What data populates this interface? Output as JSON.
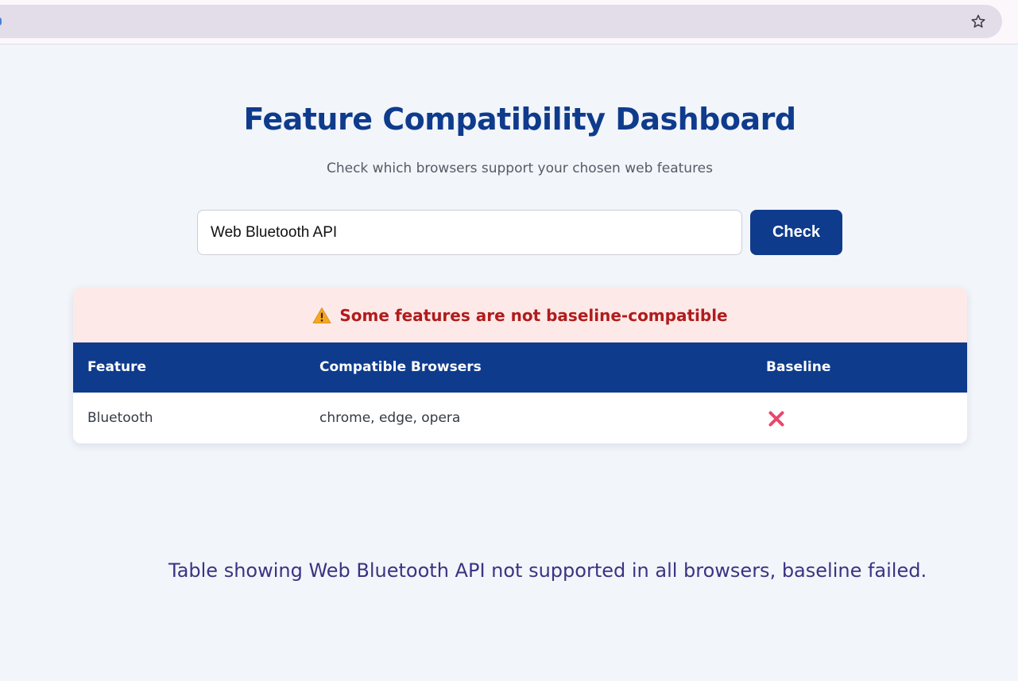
{
  "browser": {
    "star_icon": "star-outline-icon"
  },
  "dashboard": {
    "title": "Feature Compatibility Dashboard",
    "subtitle": "Check which browsers support your chosen web features"
  },
  "search": {
    "value": "Web Bluetooth API",
    "placeholder": "",
    "button_label": "Check"
  },
  "results": {
    "warning_icon": "warning-triangle-icon",
    "warning_text": "Some features are not baseline-compatible",
    "columns": [
      "Feature",
      "Compatible Browsers",
      "Baseline"
    ],
    "rows": [
      {
        "feature": "Bluetooth",
        "browsers": "chrome, edge, opera",
        "baseline_icon": "cross-mark-icon"
      }
    ]
  },
  "caption": "Table showing Web Bluetooth API not supported in all browsers, baseline failed.",
  "colors": {
    "primary": "#0e3b8c",
    "warning_bg": "#fde9e8",
    "warning_text": "#b01c1c",
    "cross": "#e8476b",
    "page_bg": "#f2f5fa"
  }
}
